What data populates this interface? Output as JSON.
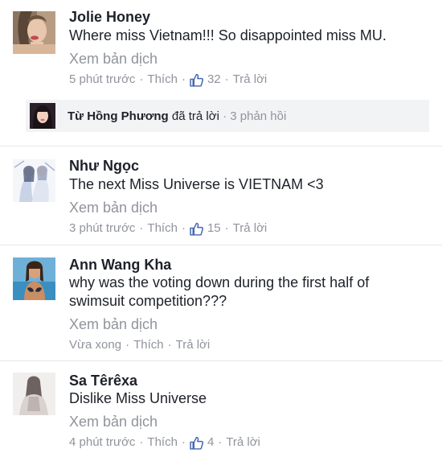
{
  "comments": [
    {
      "name": "Jolie Honey",
      "lines": [
        "Where miss Vietnam!!! So disappointed miss MU."
      ],
      "translate": "Xem bản dịch",
      "time": "5 phút trước",
      "like_action": "Thích",
      "like_count": "32",
      "reply_action": "Trả lời",
      "replies": {
        "name": "Từ Hồng Phương",
        "action": "đã trả lời",
        "count": "3 phản hồi"
      }
    },
    {
      "name": "Như Ngọc",
      "lines": [
        "The next Miss Universe is VIETNAM <3"
      ],
      "translate": "Xem bản dịch",
      "time": "3 phút trước",
      "like_action": "Thích",
      "like_count": "15",
      "reply_action": "Trả lời"
    },
    {
      "name": "Ann Wang Kha",
      "lines": [
        "why was the voting down during the first half of",
        "swimsuit competition???"
      ],
      "translate": "Xem bản dịch",
      "time": "Vừa xong",
      "like_action": "Thích",
      "reply_action": "Trả lời"
    },
    {
      "name": "Sa Têrêxa",
      "lines": [
        "Dislike Miss Universe"
      ],
      "translate": "Xem bản dịch",
      "time": "4 phút trước",
      "like_action": "Thích",
      "like_count": "4",
      "reply_action": "Trả lời"
    }
  ],
  "dot": "·",
  "colors": {
    "name": "#1d2129",
    "meta": "#90949c",
    "like_icon": "#4267b2",
    "reply_bg": "#f2f3f5",
    "divider": "#e5e6e9"
  },
  "icons": {
    "like": "thumbs-up-icon"
  }
}
